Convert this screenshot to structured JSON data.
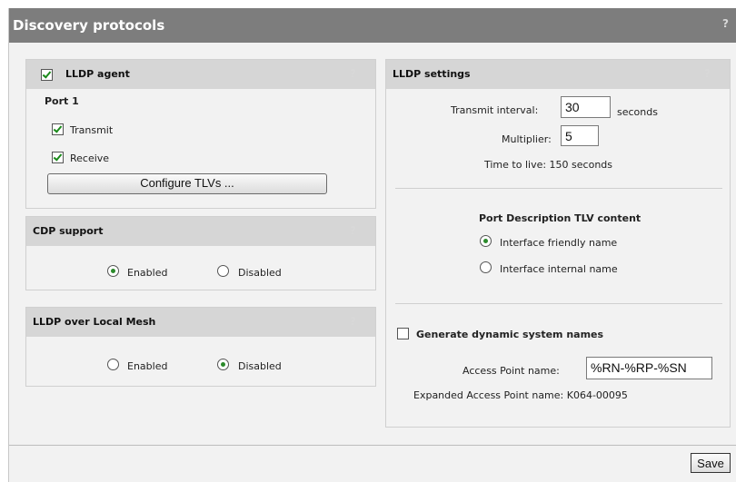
{
  "page": {
    "title": "Discovery protocols",
    "help": "?"
  },
  "lldp_agent": {
    "header": "LLDP agent",
    "checked": true,
    "help": "?",
    "port_label": "Port 1",
    "transmit_label": "Transmit",
    "transmit_checked": true,
    "receive_label": "Receive",
    "receive_checked": true,
    "configure_button": "Configure TLVs ..."
  },
  "cdp_support": {
    "header": "CDP support",
    "help": "?",
    "enabled_label": "Enabled",
    "disabled_label": "Disabled",
    "selected": "Enabled"
  },
  "lldp_mesh": {
    "header": "LLDP over Local Mesh",
    "help": "?",
    "enabled_label": "Enabled",
    "disabled_label": "Disabled",
    "selected": "Disabled"
  },
  "lldp_settings": {
    "header": "LLDP settings",
    "help": "?",
    "transmit_interval_label": "Transmit interval:",
    "transmit_interval_value": "30",
    "transmit_interval_unit": "seconds",
    "multiplier_label": "Multiplier:",
    "multiplier_value": "5",
    "ttl_text": "Time to live:  150 seconds",
    "port_desc_title": "Port Description TLV content",
    "friendly_label": "Interface friendly name",
    "internal_label": "Interface internal name",
    "port_desc_selected": "Interface friendly name",
    "generate_label": "Generate dynamic system names",
    "generate_checked": false,
    "ap_name_label": "Access Point name:",
    "ap_name_value": "%RN-%RP-%SN",
    "expanded_text": "Expanded Access Point name:  K064-00095"
  },
  "footer": {
    "save_label": "Save"
  }
}
